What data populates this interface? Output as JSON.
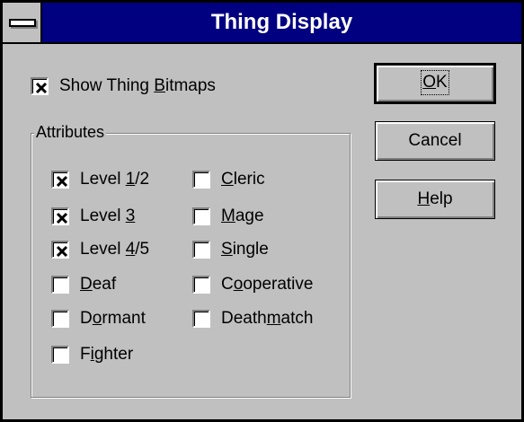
{
  "window": {
    "title": "Thing Display"
  },
  "show_bitmaps": {
    "label_pre": "Show Thing ",
    "label_ul": "B",
    "label_post": "itmaps",
    "checked": true
  },
  "attributes": {
    "group_label": "Attributes",
    "left_column": [
      {
        "pre": "Level ",
        "ul": "1",
        "post": "/2",
        "checked": true
      },
      {
        "pre": "Level ",
        "ul": "3",
        "post": "",
        "checked": true
      },
      {
        "pre": "Level ",
        "ul": "4",
        "post": "/5",
        "checked": true
      },
      {
        "pre": "",
        "ul": "D",
        "post": "eaf",
        "checked": false
      },
      {
        "pre": "D",
        "ul": "o",
        "post": "rmant",
        "checked": false
      },
      {
        "pre": "F",
        "ul": "i",
        "post": "ghter",
        "checked": false
      }
    ],
    "right_column": [
      {
        "pre": "",
        "ul": "C",
        "post": "leric",
        "checked": false
      },
      {
        "pre": "",
        "ul": "M",
        "post": "age",
        "checked": false
      },
      {
        "pre": "",
        "ul": "S",
        "post": "ingle",
        "checked": false
      },
      {
        "pre": "C",
        "ul": "o",
        "post": "operative",
        "checked": false
      },
      {
        "pre": "Death",
        "ul": "m",
        "post": "atch",
        "checked": false
      }
    ]
  },
  "buttons": {
    "ok": {
      "pre": "",
      "ul": "O",
      "post": "K"
    },
    "cancel": {
      "pre": "Cancel",
      "ul": "",
      "post": ""
    },
    "help": {
      "pre": "",
      "ul": "H",
      "post": "elp"
    }
  },
  "colors": {
    "title_bar": "#000080",
    "face": "#c0c0c0"
  }
}
